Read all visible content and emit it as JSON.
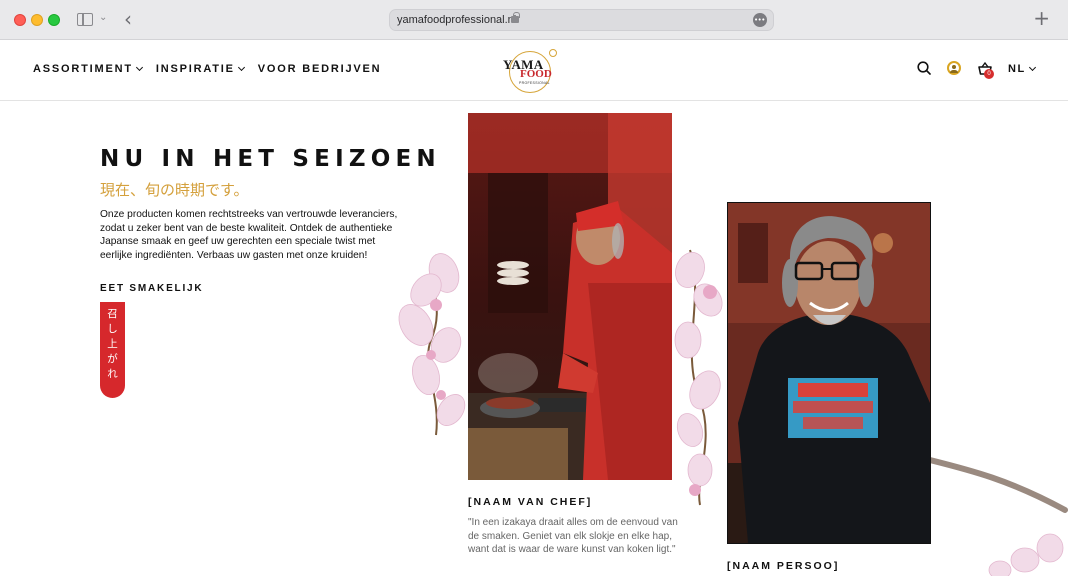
{
  "browser": {
    "url": "yamafoodprofessional.nl"
  },
  "header": {
    "nav": [
      {
        "label": "ASSORTIMENT",
        "has_dropdown": true
      },
      {
        "label": "INSPIRATIE",
        "has_dropdown": true
      },
      {
        "label": "VOOR BEDRIJVEN",
        "has_dropdown": false
      }
    ],
    "logo": {
      "line1": "YAMA",
      "line2": "FOOD",
      "line3": "PROFESSIONAL"
    },
    "cart_count": "0",
    "language": "NL"
  },
  "hero": {
    "title": "NU IN HET SEIZOEN",
    "subtitle_jp": "現在、旬の時期です。",
    "body": "Onze producten komen rechtstreeks van vertrouwde leveranciers, zodat u zeker bent van de beste kwaliteit. Ontdek de authentieke Japanse smaak en geef uw gerechten een speciale twist met eerlijke ingrediënten. Verbaas uw gasten met onze kruiden!",
    "eet_label": "EET SMAKELIJK",
    "jp_tag": "召し上がれ"
  },
  "chef": {
    "name": "[NAAM VAN CHEF]",
    "quote": "\"In een izakaya draait alles om de eenvoud van de smaken. Geniet van elk slokje en elke hap, want dat is waar de ware kunst van koken ligt.\""
  },
  "person": {
    "name": "[NAAM PERSOO]"
  },
  "colors": {
    "accent_gold": "#d4a03c",
    "brand_red": "#d6282c",
    "text": "#111111"
  },
  "icons": [
    "search-icon",
    "user-icon",
    "cart-icon",
    "chevron-down-icon",
    "lock-icon",
    "more-icon",
    "plus-icon",
    "back-icon",
    "sidebar-icon"
  ]
}
